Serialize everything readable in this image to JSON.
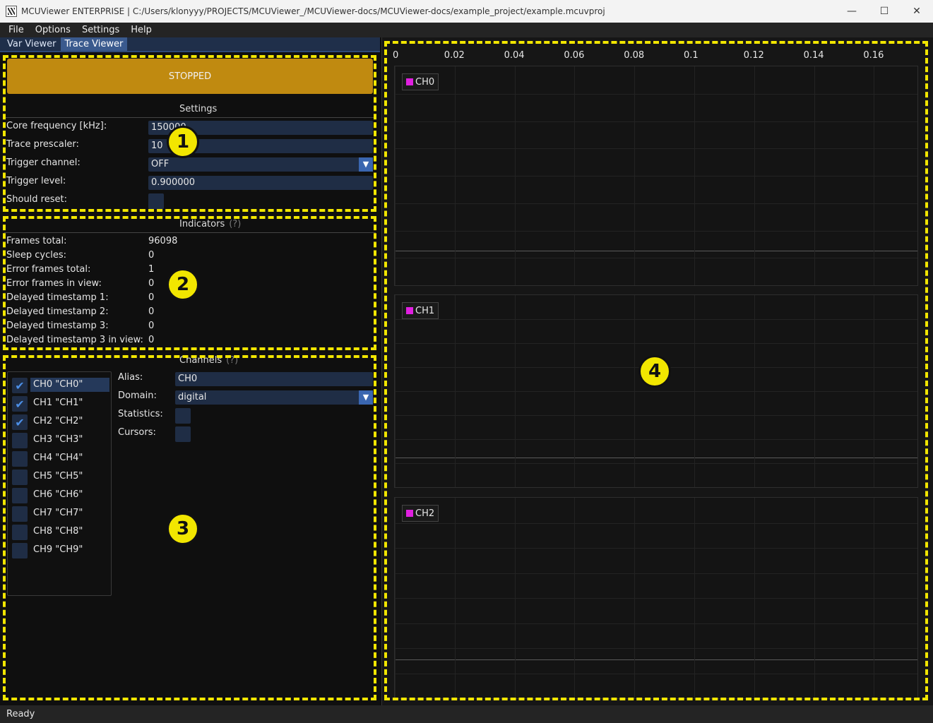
{
  "window": {
    "title": "MCUViewer ENTERPRISE | C:/Users/klonyyy/PROJECTS/MCUViewer_/MCUViewer-docs/MCUViewer-docs/example_project/example.mcuvproj",
    "minimize": "—",
    "maximize": "☐",
    "close": "✕"
  },
  "menu": [
    "File",
    "Options",
    "Settings",
    "Help"
  ],
  "tabs": [
    "Var Viewer",
    "Trace Viewer"
  ],
  "run_button": "STOPPED",
  "settings": {
    "title": "Settings",
    "core_frequency_label": "Core frequency [kHz]:",
    "core_frequency_value": "150000",
    "trace_prescaler_label": "Trace prescaler:",
    "trace_prescaler_value": "10",
    "trigger_channel_label": "Trigger channel:",
    "trigger_channel_value": "OFF",
    "trigger_level_label": "Trigger level:",
    "trigger_level_value": "0.900000",
    "should_reset_label": "Should reset:"
  },
  "indicators": {
    "title": "Indicators",
    "help": "(?)",
    "rows": [
      {
        "label": "Frames total:",
        "value": "96098"
      },
      {
        "label": "Sleep cycles:",
        "value": "0"
      },
      {
        "label": "Error frames total:",
        "value": "1"
      },
      {
        "label": "Error frames in view:",
        "value": "0"
      },
      {
        "label": "Delayed timestamp 1:",
        "value": "0"
      },
      {
        "label": "Delayed timestamp 2:",
        "value": "0"
      },
      {
        "label": "Delayed timestamp 3:",
        "value": "0"
      },
      {
        "label": "Delayed timestamp 3 in view:",
        "value": "0"
      }
    ]
  },
  "channels": {
    "title": "Channels",
    "help": "(?)",
    "list": [
      {
        "label": "CH0 \"CH0\"",
        "checked": true
      },
      {
        "label": "CH1 \"CH1\"",
        "checked": true
      },
      {
        "label": "CH2 \"CH2\"",
        "checked": true
      },
      {
        "label": "CH3 \"CH3\"",
        "checked": false
      },
      {
        "label": "CH4 \"CH4\"",
        "checked": false
      },
      {
        "label": "CH5 \"CH5\"",
        "checked": false
      },
      {
        "label": "CH6 \"CH6\"",
        "checked": false
      },
      {
        "label": "CH7 \"CH7\"",
        "checked": false
      },
      {
        "label": "CH8 \"CH8\"",
        "checked": false
      },
      {
        "label": "CH9 \"CH9\"",
        "checked": false
      }
    ],
    "alias_label": "Alias:",
    "alias_value": "CH0",
    "domain_label": "Domain:",
    "domain_value": "digital",
    "statistics_label": "Statistics:",
    "cursors_label": "Cursors:"
  },
  "plot": {
    "x_ticks": [
      "0",
      "0.02",
      "0.04",
      "0.06",
      "0.08",
      "0.1",
      "0.12",
      "0.14",
      "0.16"
    ],
    "x_range": [
      0,
      0.175
    ],
    "series_color": "#e020e0",
    "panels": [
      {
        "legend": "CH0"
      },
      {
        "legend": "CH1"
      },
      {
        "legend": "CH2"
      }
    ]
  },
  "annotations": [
    "1",
    "2",
    "3",
    "4"
  ],
  "accent_colors": {
    "highlight": "#f2e600",
    "stopped": "#c08a10",
    "input": "#1f2d45"
  },
  "status": "Ready"
}
